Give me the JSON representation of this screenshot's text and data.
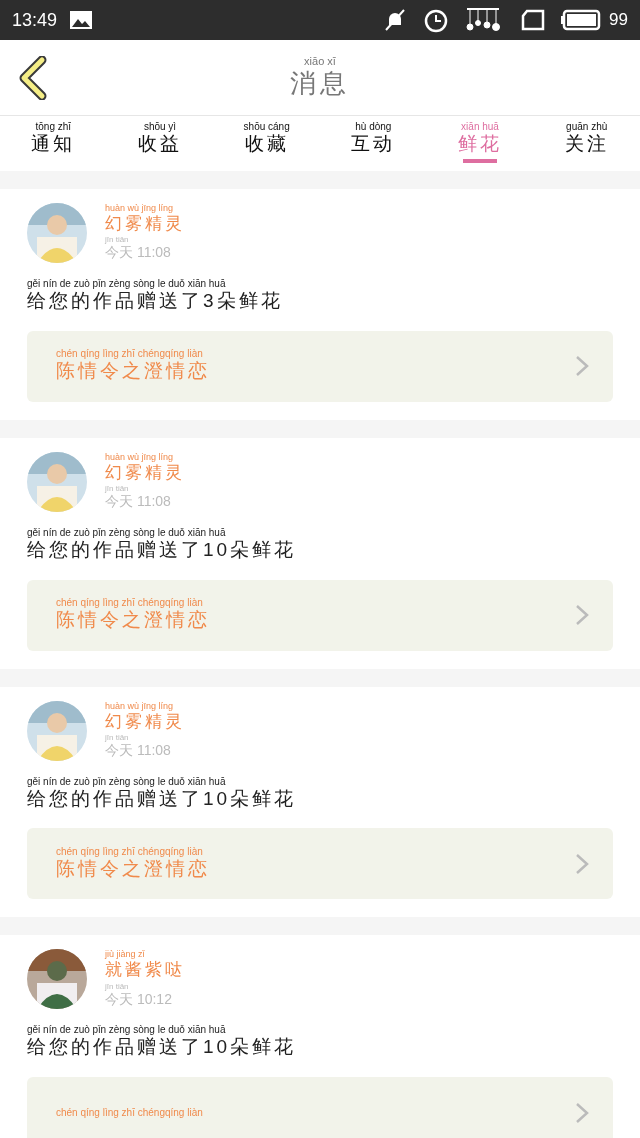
{
  "status_bar": {
    "time": "13:49",
    "battery": "99"
  },
  "header": {
    "title": "消息",
    "title_pinyin": "xiāo xī"
  },
  "tabs": [
    {
      "label": "通知",
      "pinyin": "tōng zhī",
      "selected": false
    },
    {
      "label": "收益",
      "pinyin": "shōu yì",
      "selected": false
    },
    {
      "label": "收藏",
      "pinyin": "shōu cáng",
      "selected": false
    },
    {
      "label": "互动",
      "pinyin": "hù dòng",
      "selected": false
    },
    {
      "label": "鲜花",
      "pinyin": "xiān huā",
      "selected": true
    },
    {
      "label": "关注",
      "pinyin": "guān zhù",
      "selected": false
    }
  ],
  "messages": [
    {
      "user": "幻雾精灵",
      "user_pinyin": "huàn wù jīng líng",
      "day": "今天",
      "day_pinyin": "jīn tiān",
      "time": "11:08",
      "text": "给您的作品赠送了3朵鲜花",
      "text_pinyin": "gěi nín de zuò pǐn zèng sòng le duǒ xiān huā",
      "work": {
        "title": "陈情令之澄情恋",
        "pinyin": "chén qíng lìng zhī chéngqíng liàn"
      }
    },
    {
      "user": "幻雾精灵",
      "user_pinyin": "huàn wù jīng líng",
      "day": "今天",
      "day_pinyin": "jīn tiān",
      "time": "11:08",
      "text": "给您的作品赠送了10朵鲜花",
      "text_pinyin": "gěi nín de zuò pǐn zèng sòng le duǒ xiān huā",
      "work": {
        "title": "陈情令之澄情恋",
        "pinyin": "chén qíng lìng zhī chéngqíng liàn"
      }
    },
    {
      "user": "幻雾精灵",
      "user_pinyin": "huàn wù jīng líng",
      "day": "今天",
      "day_pinyin": "jīn tiān",
      "time": "11:08",
      "text": "给您的作品赠送了10朵鲜花",
      "text_pinyin": "gěi nín de zuò pǐn zèng sòng le duǒ xiān huā",
      "work": {
        "title": "陈情令之澄情恋",
        "pinyin": "chén qíng lìng zhī chéngqíng liàn"
      }
    },
    {
      "user": "就酱紫哒",
      "user_pinyin": "jiù jiàng zǐ",
      "day": "今天",
      "day_pinyin": "jīn tiān",
      "time": "10:12",
      "text": "给您的作品赠送了10朵鲜花",
      "text_pinyin": "gěi nín de zuò pǐn zèng sòng le duǒ xiān huā",
      "work": {
        "pinyin": "chén qíng lìng zhī chéngqíng liàn"
      }
    }
  ]
}
